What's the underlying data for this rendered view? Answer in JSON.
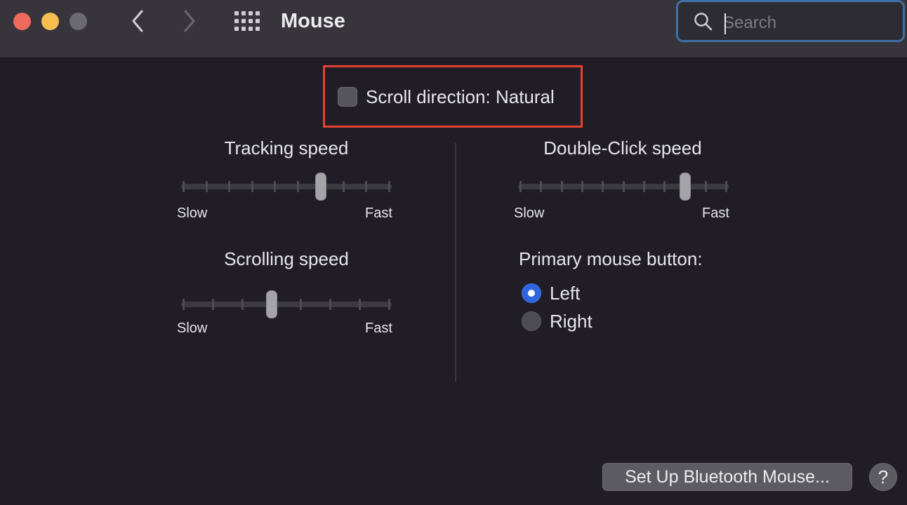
{
  "window": {
    "title": "Mouse"
  },
  "search": {
    "placeholder": "Search",
    "value": ""
  },
  "scroll_direction": {
    "label": "Scroll direction: Natural",
    "checked": false
  },
  "tracking_speed": {
    "title": "Tracking speed",
    "min_label": "Slow",
    "max_label": "Fast",
    "ticks": 10,
    "position": 6
  },
  "double_click_speed": {
    "title": "Double-Click speed",
    "min_label": "Slow",
    "max_label": "Fast",
    "ticks": 11,
    "position": 8
  },
  "scrolling_speed": {
    "title": "Scrolling speed",
    "min_label": "Slow",
    "max_label": "Fast",
    "ticks": 8,
    "position": 3
  },
  "primary_button": {
    "label": "Primary mouse button:",
    "options": [
      "Left",
      "Right"
    ],
    "selected": "Left"
  },
  "buttons": {
    "bluetooth": "Set Up Bluetooth Mouse...",
    "help": "?"
  },
  "colors": {
    "accent": "#2f66e0",
    "highlight": "#e2432f",
    "search_focus": "#3e6fa8"
  }
}
